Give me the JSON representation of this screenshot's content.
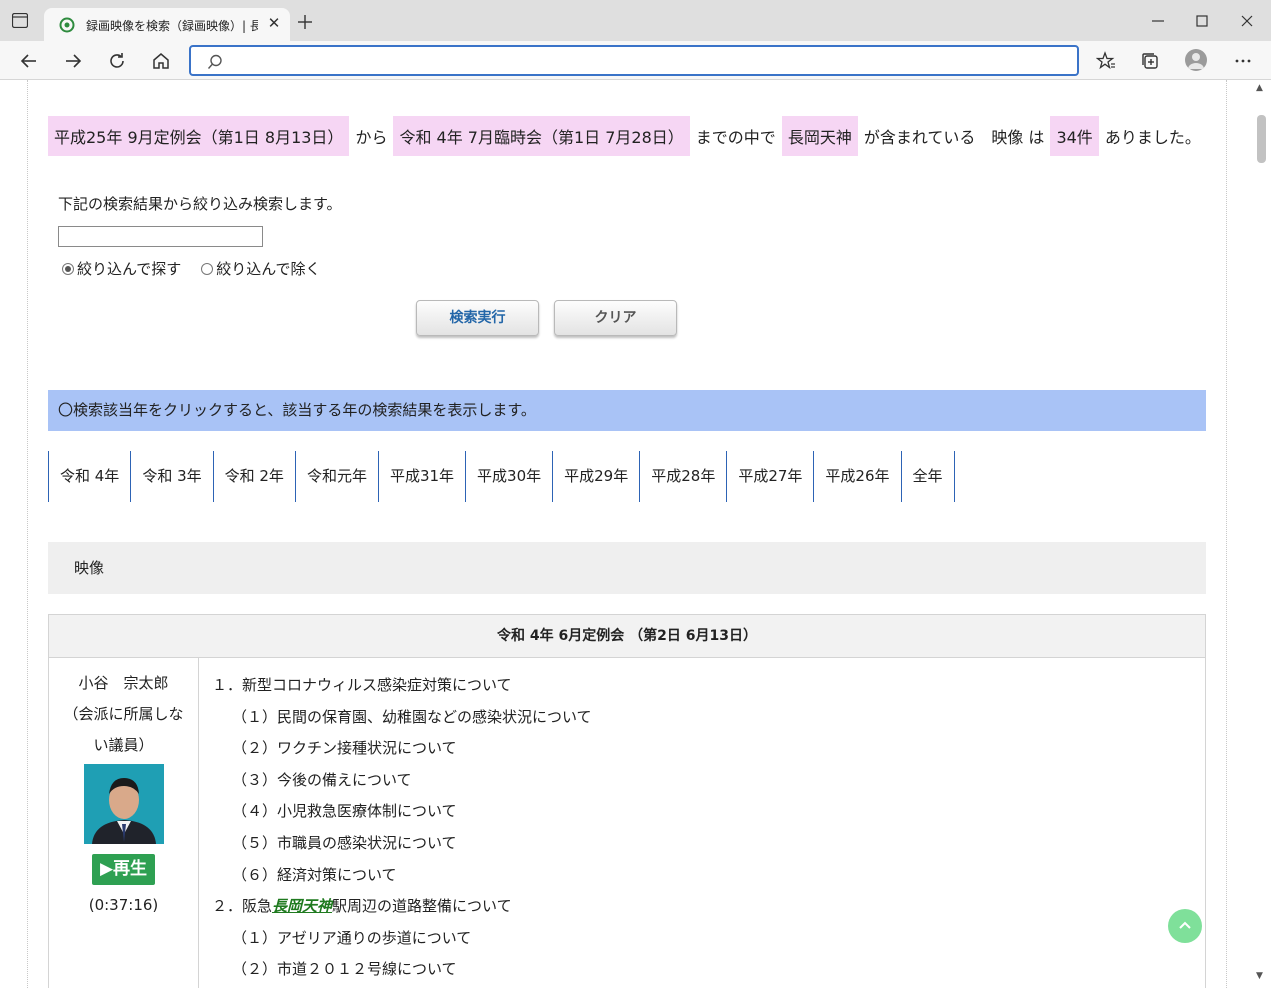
{
  "browser": {
    "tab_title": "録画映像を検索（録画映像）| 長",
    "address_value": "",
    "colors": {
      "accent": "#3a73c8"
    }
  },
  "summary": {
    "from_label": "平成25年 9月定例会（第1日 8月13日）",
    "from_suffix": "から",
    "to_label": "令和 4年 7月臨時会（第1日 7月28日）",
    "to_suffix": "までの中で",
    "keyword": "長岡天神",
    "keyword_suffix": "が含まれている　映像 は",
    "count": "34件",
    "count_suffix": "ありました。"
  },
  "refine": {
    "caption": "下記の検索結果から絞り込み検索します。",
    "input_value": "",
    "option_include": "絞り込んで探す",
    "option_exclude": "絞り込んで除く",
    "selected": "include",
    "search_button": "検索実行",
    "clear_button": "クリア"
  },
  "notice": "〇検索該当年をクリックすると、該当する年の検索結果を表示します。",
  "years": [
    "令和 4年",
    "令和 3年",
    "令和 2年",
    "令和元年",
    "平成31年",
    "平成30年",
    "平成29年",
    "平成28年",
    "平成27年",
    "平成26年",
    "全年"
  ],
  "section_title": "映像",
  "result": {
    "session_title": "令和 4年 6月定例会 （第2日 6月13日）",
    "speaker_name": "小谷　宗太郎",
    "speaker_party": "（会派に所属しない議員）",
    "play_label": "再生",
    "duration": "(0:37:16)",
    "topics": [
      {
        "text": "１．新型コロナウィルス感染症対策について",
        "sub": false
      },
      {
        "text": "（１）民間の保育園、幼稚園などの感染状況について",
        "sub": true
      },
      {
        "text": "（２）ワクチン接種状況について",
        "sub": true
      },
      {
        "text": "（３）今後の備えについて",
        "sub": true
      },
      {
        "text": "（４）小児救急医療体制について",
        "sub": true
      },
      {
        "text": "（５）市職員の感染状況について",
        "sub": true
      },
      {
        "text": "（６）経済対策について",
        "sub": true
      }
    ],
    "topic2_prefix": "２．阪急",
    "topic2_keyword": "長岡天神",
    "topic2_suffix": "駅周辺の道路整備について",
    "topics_after": [
      {
        "text": "（１）アゼリア通りの歩道について",
        "sub": true
      },
      {
        "text": "（２）市道２０１２号線について",
        "sub": true
      }
    ]
  }
}
